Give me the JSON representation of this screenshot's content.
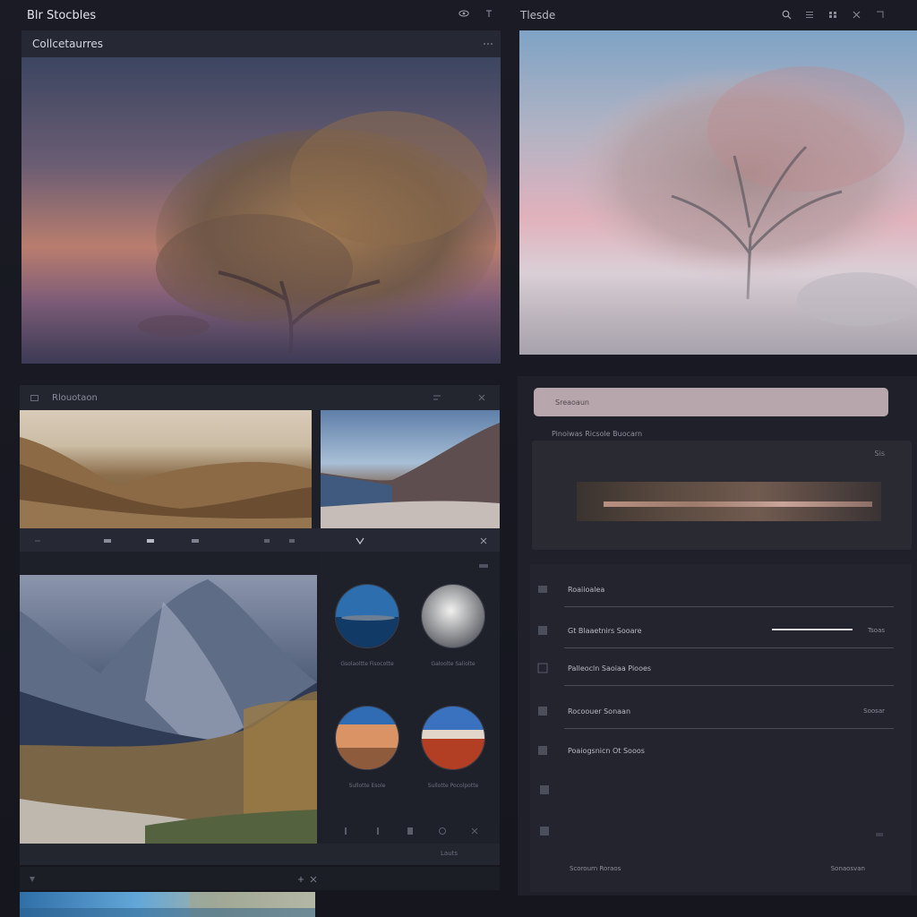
{
  "app": {
    "title": "Blr Stocbles",
    "panel_title": "Tlesde"
  },
  "hero_left": {
    "header": "Collcetaurres"
  },
  "lower_left": {
    "header": "Rlouotaon",
    "circles": [
      {
        "caption": "Gsolaoltte Fisocotte",
        "colors": [
          "#3a79b5",
          "#0d2f55"
        ]
      },
      {
        "caption": "Galoolte Saliolte",
        "colors": [
          "#d9d9da",
          "#5f6368"
        ]
      },
      {
        "caption": "Sullotte Esole",
        "colors": [
          "#e6a26a",
          "#7d4d35"
        ]
      },
      {
        "caption": "Sullotte Pocolpotte",
        "colors": [
          "#3f76c0",
          "#b44a2c"
        ]
      }
    ],
    "footer_page": "Lauts"
  },
  "right_panel": {
    "search_placeholder": "Sreaoaun",
    "subheading": "Pinoiwas Ricsole Buocarn",
    "preview_corner": "Sis",
    "settings": [
      {
        "label": "Roaiioalea",
        "value": ""
      },
      {
        "label": "Gt Blaaetnirs Sooare",
        "value": "Tsoas"
      },
      {
        "label": "Palleocln Saoiaa Piooes",
        "value": ""
      },
      {
        "label": "Rocoouer Sonaan",
        "value": "Soosar"
      },
      {
        "label": "Poaiogsnicn Ot Sooos",
        "value": ""
      }
    ],
    "footer_left": "Scorourn Roraos",
    "footer_right": "Sonaosvan"
  },
  "colors": {
    "background": "#171820",
    "accent_search": "#b7a7ad",
    "panel": "#1f2029"
  }
}
